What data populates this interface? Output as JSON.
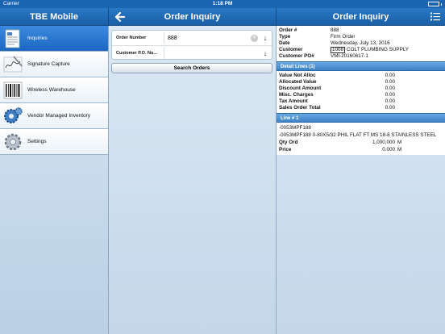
{
  "statusbar": {
    "carrier": "Carrier",
    "time": "1:18 PM",
    "battery_level": 1.0
  },
  "left_nav": {
    "title": "TBE Mobile"
  },
  "mid_nav": {
    "title": "Order Inquiry"
  },
  "right_nav": {
    "title": "Order Inquiry"
  },
  "sidebar": {
    "items": [
      {
        "label": "Inquiries",
        "icon": "document-icon",
        "active": true
      },
      {
        "label": "Signature Capture",
        "icon": "signature-icon",
        "active": false
      },
      {
        "label": "Wireless Warehouse",
        "icon": "barcode-icon",
        "active": false
      },
      {
        "label": "Vendor Managed Inventory",
        "icon": "gears-icon",
        "active": false
      },
      {
        "label": "Settings",
        "icon": "gear-icon",
        "active": false
      }
    ]
  },
  "form": {
    "order_number_label": "Order Number",
    "order_number_value": "888",
    "customer_po_label": "Customer P.O. Nu...",
    "customer_po_value": "",
    "search_button": "Search Orders"
  },
  "order": {
    "order_no_label": "Order #",
    "order_no": "888",
    "type_label": "Type",
    "type": "Firm Order",
    "date_label": "Date",
    "date": "Wednesday, July 13, 2016",
    "customer_label": "Customer",
    "customer_code": "1008",
    "customer_name": "COLT PLUMBING SUPPLY",
    "customer_po_label": "Customer PO#",
    "customer_po": "VMI-20160617-1"
  },
  "totals": {
    "section_title": "Detail Lines (1)",
    "rows": [
      {
        "label": "Value Not Alloc",
        "value": "0.00"
      },
      {
        "label": "Allocated Value",
        "value": "0.00"
      },
      {
        "label": "Discount Amount",
        "value": "0.00"
      },
      {
        "label": "Misc. Charges",
        "value": "0.00"
      },
      {
        "label": "Tax Amount",
        "value": "0.00"
      },
      {
        "label": "Sales Order Total",
        "value": "0.00"
      }
    ]
  },
  "line": {
    "section_title": "Line # 1",
    "item_code": "-0053MPF188",
    "description": "-0053MPF188 0-80X5/32 PHIL FLAT FT MS 18-8 STAINLESS STEEL",
    "qty_label": "Qty Ord",
    "qty": "1,000,000",
    "qty_unit": "M",
    "price_label": "Price",
    "price": "0.000",
    "price_unit": "M"
  }
}
